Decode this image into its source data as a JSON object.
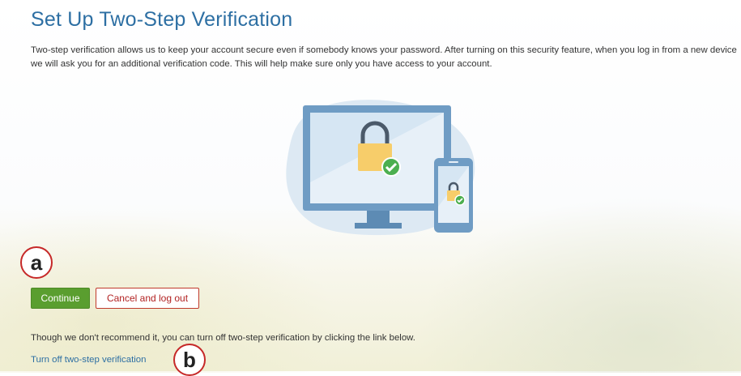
{
  "page": {
    "title": "Set Up Two-Step Verification",
    "description": "Two-step verification allows us to keep your account secure even if somebody knows your password. After turning on this security feature, when you log in from a new device we will ask you for an additional verification code. This will help make sure only you have access to your account."
  },
  "annotations": {
    "a": "a",
    "b": "b"
  },
  "actions": {
    "continue_label": "Continue",
    "cancel_label": "Cancel and log out"
  },
  "turn_off": {
    "note": "Though we don't recommend it, you can turn off two-step verification by clicking the link below.",
    "link_label": "Turn off two-step verification"
  },
  "colors": {
    "title": "#2d6fa3",
    "continue": "#5a9e2f",
    "cancel_border": "#c0392b",
    "illustration_blob": "#dde9f3",
    "illustration_device": "#6f9cc4",
    "lock": "#f7cd6a",
    "check": "#4caf50"
  }
}
